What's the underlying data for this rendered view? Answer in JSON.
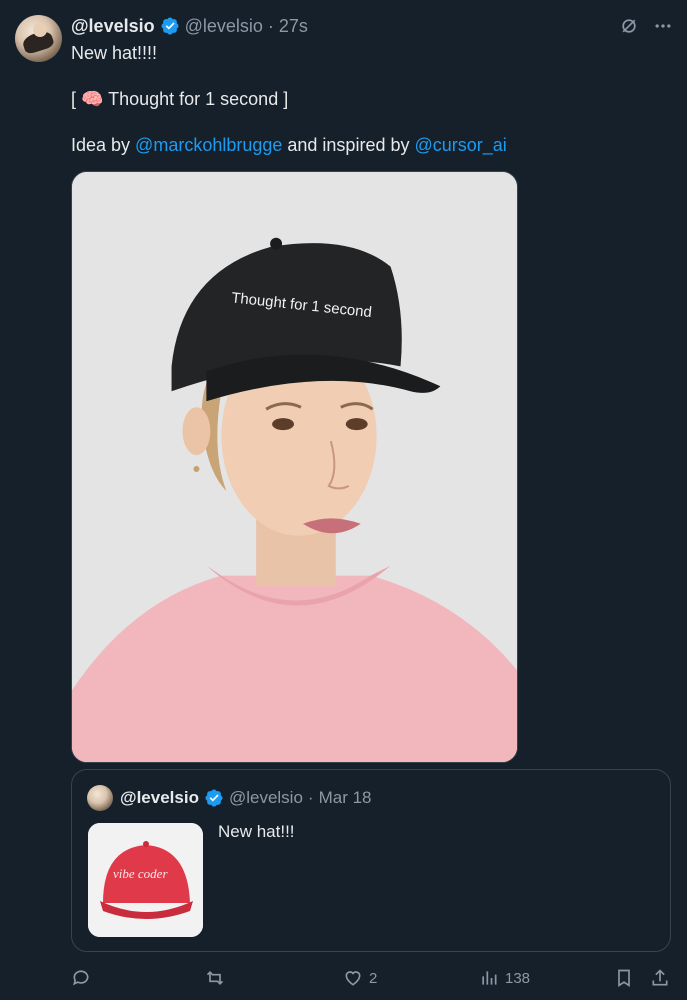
{
  "tweet": {
    "display_name": "@levelsio",
    "handle": "@levelsio",
    "separator": "·",
    "time": "27s",
    "line1": "New hat!!!!",
    "line2": "[ 🧠 Thought for 1 second ]",
    "line3_prefix": "Idea by ",
    "mention1": "@marckohlbrugge",
    "line3_middle": " and inspired by ",
    "mention2": "@cursor_ai",
    "media_alt": "Woman wearing black cap with Thought for 1 second embroidery",
    "hat_text": "Thought for 1 second"
  },
  "quote": {
    "display_name": "@levelsio",
    "handle": "@levelsio",
    "separator": "·",
    "date": "Mar 18",
    "text": "New hat!!!",
    "hat_text": "vibe coder"
  },
  "actions": {
    "likes": "2",
    "views": "138"
  },
  "icons": [
    "grok-icon",
    "more-icon",
    "verified-icon",
    "reply-icon",
    "retweet-icon",
    "like-icon",
    "views-icon",
    "bookmark-icon",
    "share-icon"
  ],
  "colors": {
    "background": "#15202b",
    "accent": "#1d9bf0",
    "muted": "#8b98a5",
    "text": "#e7e9ea"
  }
}
